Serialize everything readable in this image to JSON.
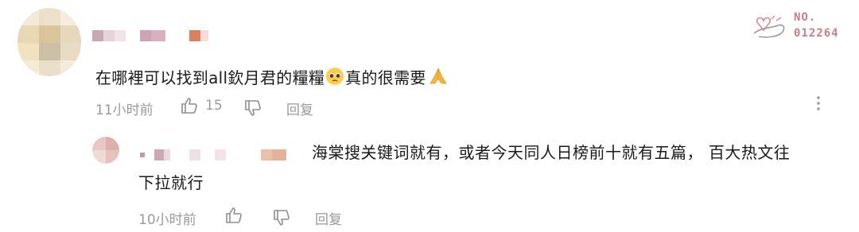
{
  "badge": {
    "prefix": "NO.",
    "number": "012264"
  },
  "comment": {
    "text": "在哪裡可以找到all欽月君的糧糧",
    "text_after": "真的很需要",
    "time": "11小时前",
    "like_count": "15",
    "reply_label": "回复"
  },
  "reply": {
    "text_line1": "海棠搜关键词就有，或者今天同人日榜前十就有五篇，  百大热文往",
    "text_line2": "下拉就行",
    "time": "10小时前",
    "reply_label": "回复"
  },
  "colors": {
    "text": "#1a1a1a",
    "meta": "#9a9a9a",
    "icon": "#8e8e8e"
  },
  "icons": [
    "heart-doodle-icon",
    "pleading-face-emoji",
    "folded-hands-emoji",
    "thumbs-up-icon",
    "thumbs-down-icon"
  ]
}
